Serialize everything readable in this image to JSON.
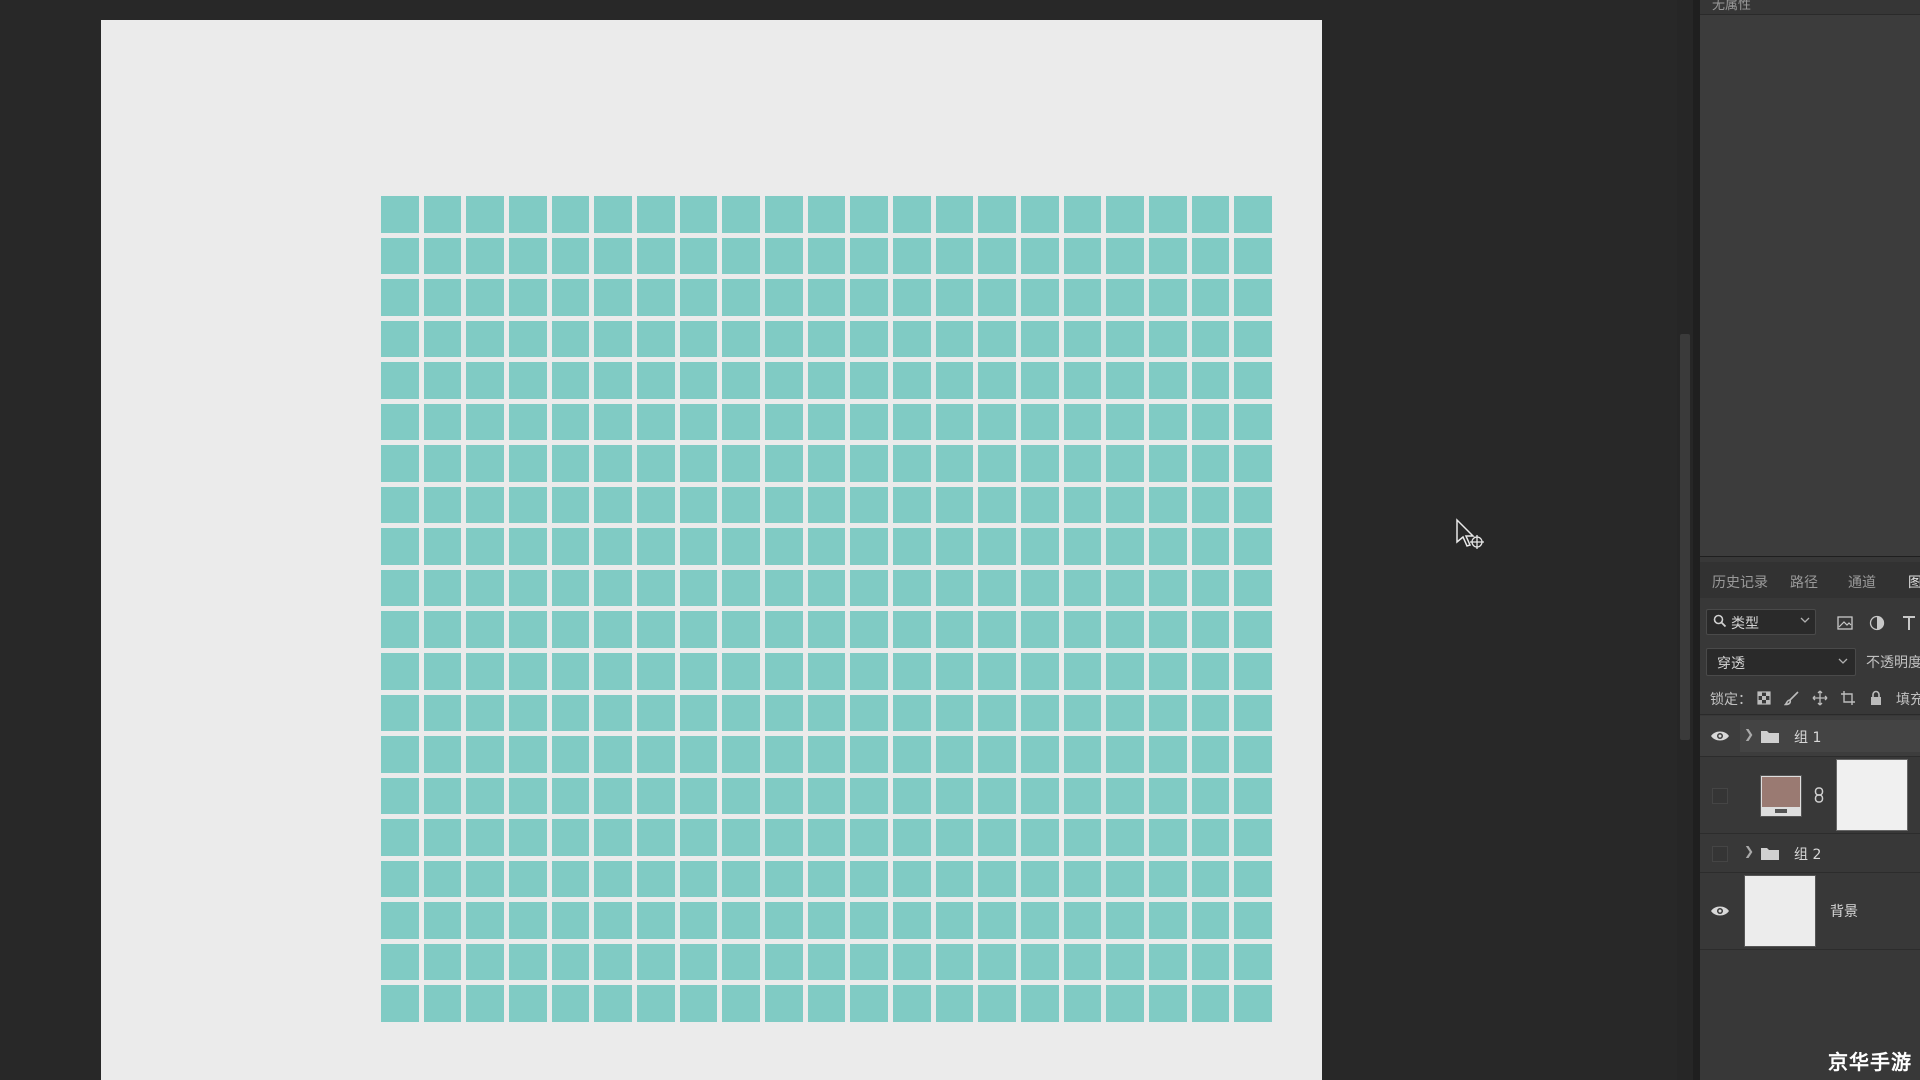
{
  "document": {
    "grid_rows": 20,
    "grid_cols": 21,
    "cell_color": "#80cbc4",
    "canvas_color": "#ebebeb"
  },
  "properties_panel": {
    "title": "无属性"
  },
  "tabs": [
    "历史记录",
    "路径",
    "通道",
    "图"
  ],
  "active_tab": "图",
  "layers_panel": {
    "filter_label": "类型",
    "filter_icons": [
      "image-filter-icon",
      "adjustment-filter-icon",
      "type-filter-icon"
    ],
    "blend_mode": "穿透",
    "opacity_label": "不透明度",
    "lock_label": "锁定：",
    "lock_icons": [
      "lock-transparent-icon",
      "lock-paint-icon",
      "lock-move-icon",
      "lock-artboard-icon",
      "lock-all-icon"
    ],
    "fill_label": "填充",
    "layers": [
      {
        "name": "组 1",
        "type": "group",
        "visible": true,
        "selected": true
      },
      {
        "name": "",
        "type": "masked-layer",
        "visible": false,
        "thumb_color": "#9a7a72",
        "mask_color": "#f0f0f0"
      },
      {
        "name": "组 2",
        "type": "group",
        "visible": false
      },
      {
        "name": "背景",
        "type": "background",
        "visible": true,
        "thumb_color": "#ececec"
      }
    ]
  },
  "watermark": "京华手游"
}
